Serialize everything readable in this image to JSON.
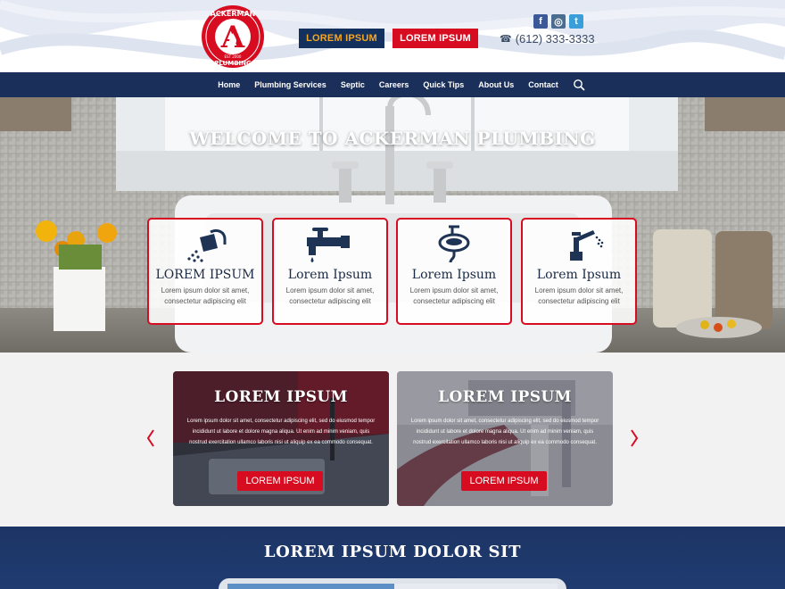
{
  "header": {
    "logo": {
      "top_text": "ACKERMAN",
      "letter": "A",
      "est": "EST 2000",
      "bottom_text": "PLUMBING"
    },
    "buttons": {
      "primary": "LOREM IPSUM",
      "secondary": "LOREM IPSUM"
    },
    "phone": "(612) 333-3333",
    "social": {
      "facebook": "f",
      "instagram": "◎",
      "twitter": "t"
    }
  },
  "nav": {
    "items": [
      "Home",
      "Plumbing Services",
      "Septic",
      "Careers",
      "Quick Tips",
      "About Us",
      "Contact"
    ]
  },
  "hero": {
    "title": "WELCOME TO ACKERMAN PLUMBING",
    "cards": [
      {
        "title": "LOREM IPSUM",
        "icon": "shower-icon",
        "text": "Lorem ipsum dolor sit amet, consectetur adipiscing elit"
      },
      {
        "title": "Lorem Ipsum",
        "icon": "faucet-icon",
        "text": "Lorem ipsum dolor sit amet, consectetur adipiscing elit"
      },
      {
        "title": "Lorem Ipsum",
        "icon": "sink-icon",
        "text": "Lorem ipsum dolor sit amet, consectetur adipiscing elit"
      },
      {
        "title": "Lorem Ipsum",
        "icon": "kitchen-faucet-icon",
        "text": "Lorem ipsum dolor sit amet, consectetur adipiscing elit"
      }
    ]
  },
  "promo": {
    "cards": [
      {
        "title": "LOREM IPSUM",
        "text": "Lorem ipsum dolor sit amet, consectetur adipiscing elit, sed do eiusmod tempor incididunt ut labore et dolore magna aliqua. Ut enim ad minim veniam, quis nostrud exercitation ullamco laboris nisi ut aliquip ex ea commodo consequat.",
        "button": "LOREM IPSUM"
      },
      {
        "title": "LOREM IPSUM",
        "text": "Lorem ipsum dolor sit amet, consectetur adipiscing elit, sed do eiusmod tempor incididunt ut labore et dolore magna aliqua. Ut enim ad minim veniam, quis nostrud exercitation ullamco laboris nisi ut aliquip ex ea commodo consequat.",
        "button": "LOREM IPSUM"
      }
    ]
  },
  "band": {
    "title": "LOREM IPSUM DOLOR SIT"
  },
  "colors": {
    "navy": "#1a2f5a",
    "red": "#d80c20",
    "gold": "#f5a623"
  }
}
